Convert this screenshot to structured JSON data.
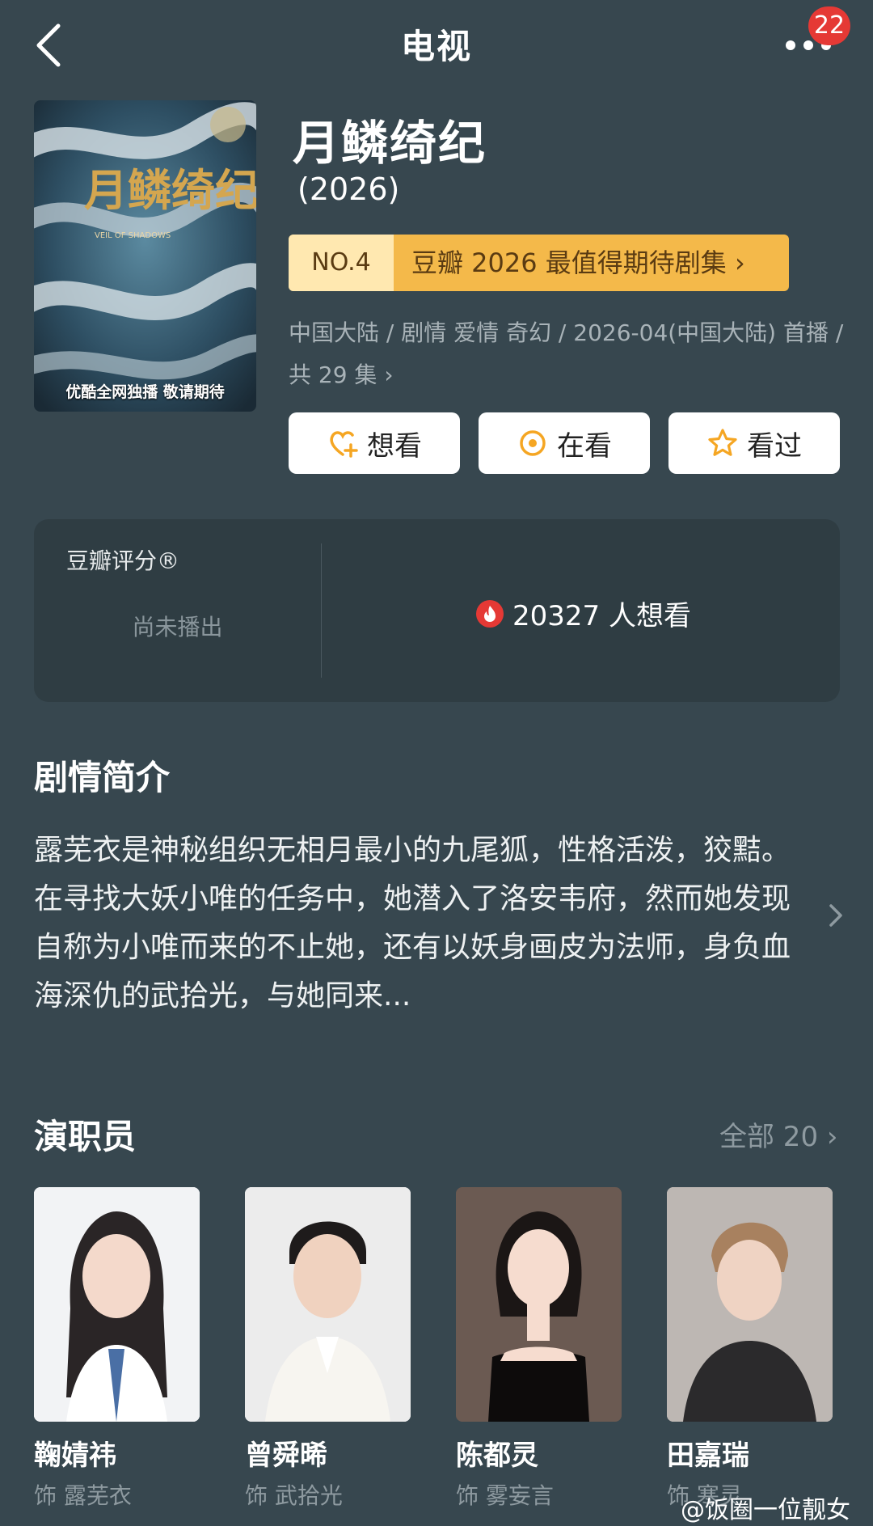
{
  "nav": {
    "title": "电视",
    "badge": "22",
    "back_icon": "chevron-left-icon",
    "more_icon": "more-dots-icon"
  },
  "poster": {
    "caption": "优酷全网独播 敬请期待",
    "art_title": "月鳞绮纪",
    "art_subtitle": "VEIL OF SHADOWS"
  },
  "show": {
    "title": "月鳞绮纪",
    "year": "(2026)",
    "rank_no": "NO.4",
    "rank_text": "豆瓣 2026 最值得期待剧集 ›",
    "meta": "中国大陆 / 剧情 爱情 奇幻 / 2026-04(中国大陆) 首播 / 共 29 集 ›"
  },
  "actions": [
    {
      "label": "想看",
      "icon": "heart-plus-icon"
    },
    {
      "label": "在看",
      "icon": "target-circle-icon"
    },
    {
      "label": "看过",
      "icon": "star-outline-icon"
    }
  ],
  "rating": {
    "label": "豆瓣评分®",
    "status": "尚未播出",
    "want_count": "20327 人想看"
  },
  "synopsis": {
    "title": "剧情简介",
    "text": "露芜衣是神秘组织无相月最小的九尾狐，性格活泼，狡黠。在寻找大妖小唯的任务中，她潜入了洛安韦府，然而她发现自称为小唯而来的不止她，还有以妖身画皮为法师，身负血海深仇的武拾光，与她同来..."
  },
  "cast": {
    "title": "演职员",
    "all_label": "全部 20 ›",
    "members": [
      {
        "name": "鞠婧祎",
        "role": "饰 露芜衣"
      },
      {
        "name": "曾舜晞",
        "role": "饰 武拾光"
      },
      {
        "name": "陈都灵",
        "role": "饰 雾妄言"
      },
      {
        "name": "田嘉瑞",
        "role": "饰 寒灵"
      }
    ]
  },
  "watermark": "@饭圈一位靓女",
  "colors": {
    "background": "#37474f",
    "card": "#2f3d43",
    "rank_gold": "#f4b94a",
    "accent_orange": "#f5a623",
    "fire_red": "#e53935"
  }
}
